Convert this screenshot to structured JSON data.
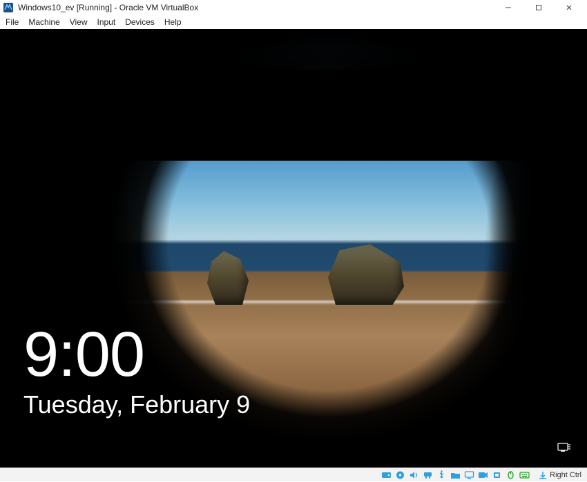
{
  "window": {
    "title": "Windows10_ev [Running] - Oracle VM VirtualBox"
  },
  "menu": {
    "file": "File",
    "machine": "Machine",
    "view": "View",
    "input": "Input",
    "devices": "Devices",
    "help": "Help"
  },
  "lockscreen": {
    "time": "9:00",
    "date": "Tuesday, February 9"
  },
  "statusbar": {
    "host_key": "Right Ctrl"
  },
  "icons": {
    "app": "virtualbox-icon",
    "minimize": "minimize-icon",
    "maximize": "maximize-icon",
    "close": "close-icon",
    "hard_disk": "hard-disk-icon",
    "optical": "optical-disc-icon",
    "audio": "audio-icon",
    "network": "network-adapter-icon",
    "usb": "usb-icon",
    "shared": "shared-folder-icon",
    "display": "display-icon",
    "recording": "recording-icon",
    "cpu": "cpu-icon",
    "mouse": "mouse-integration-icon",
    "keyboard": "keyboard-icon",
    "hostkey_arrow": "hostkey-indicator-icon",
    "guest_network": "guest-network-icon"
  }
}
